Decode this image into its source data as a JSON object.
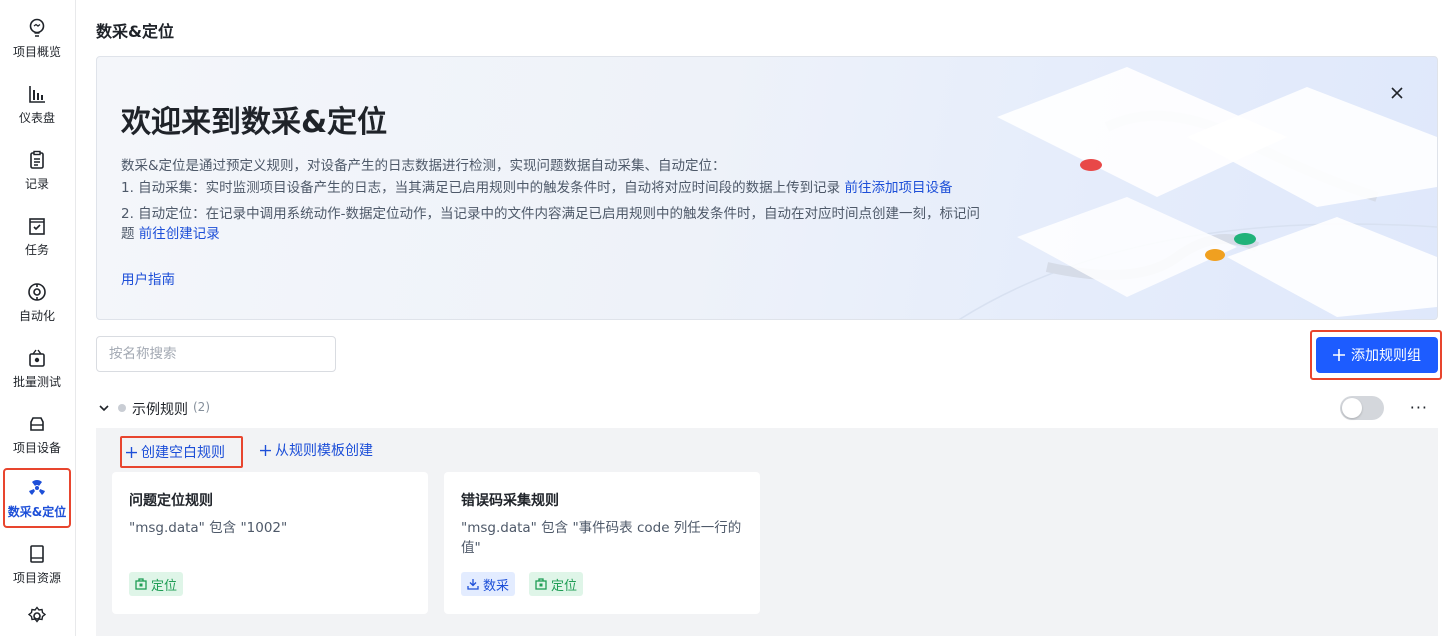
{
  "sidebar": {
    "items": [
      {
        "label": "项目概览",
        "icon": "bulb-icon"
      },
      {
        "label": "仪表盘",
        "icon": "bar-chart-icon"
      },
      {
        "label": "记录",
        "icon": "clipboard-icon"
      },
      {
        "label": "任务",
        "icon": "task-icon"
      },
      {
        "label": "自动化",
        "icon": "automation-icon"
      },
      {
        "label": "批量测试",
        "icon": "batch-test-icon"
      },
      {
        "label": "项目设备",
        "icon": "device-icon"
      },
      {
        "label": "数采&定位",
        "icon": "radiation-icon",
        "active": true
      },
      {
        "label": "项目资源",
        "icon": "book-icon"
      },
      {
        "label": "",
        "icon": "settings-icon"
      }
    ]
  },
  "page": {
    "title": "数采&定位"
  },
  "banner": {
    "title": "欢迎来到数采&定位",
    "intro": "数采&定位是通过预定义规则，对设备产生的日志数据进行检测，实现问题数据自动采集、自动定位：",
    "item1_text": "1. 自动采集：实时监测项目设备产生的日志，当其满足已启用规则中的触发条件时，自动将对应时间段的数据上传到记录",
    "item1_link": "前往添加项目设备",
    "item2_text_a": "2. 自动定位：在记录中调用系统动作-数据定位动作，当记录中的文件内容满足已启用规则中的触发条件时，自动在对应时间点创建一刻，标记问",
    "item2_text_b": "题",
    "item2_link": "前往创建记录",
    "guide_link": "用户指南"
  },
  "search": {
    "placeholder": "按名称搜索",
    "value": ""
  },
  "add_group_button": "添加规则组",
  "group": {
    "name": "示例规则",
    "count": "(2)",
    "enabled": false,
    "create_blank": "创建空白规则",
    "create_from_template": "从规则模板创建",
    "rules": [
      {
        "title": "问题定位规则",
        "desc": "\"msg.data\" 包含 \"1002\"",
        "tags": [
          {
            "label": "定位",
            "kind": "green"
          }
        ]
      },
      {
        "title": "错误码采集规则",
        "desc": "\"msg.data\" 包含 \"事件码表 code 列任一行的值\"",
        "tags": [
          {
            "label": "数采",
            "kind": "blue"
          },
          {
            "label": "定位",
            "kind": "green"
          }
        ]
      }
    ]
  },
  "colors": {
    "primary": "#1d5cff",
    "link": "#1d4fd8",
    "highlight": "#e8452e"
  }
}
